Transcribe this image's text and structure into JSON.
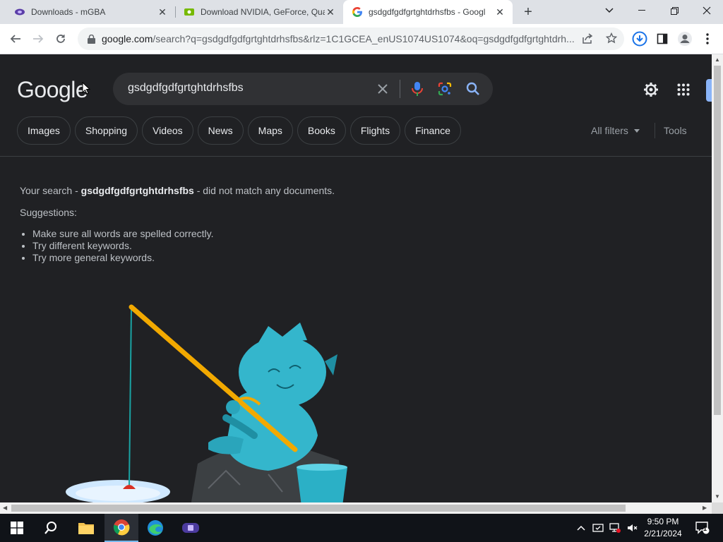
{
  "tabs": [
    {
      "title": "Downloads - mGBA",
      "icon": "mgba-icon"
    },
    {
      "title": "Download NVIDIA, GeForce, Qua",
      "icon": "nvidia-icon"
    },
    {
      "title": "gsdgdfgdfgrtghtdrhsfbs - Googl",
      "icon": "google-icon",
      "active": true
    }
  ],
  "address": {
    "host": "google.com",
    "path": "/search?q=gsdgdfgdfgrtghtdrhsfbs&rlz=1C1GCEA_enUS1074US1074&oq=gsdgdfgdfgrtghtdrh..."
  },
  "google": {
    "logo": "Google",
    "query": "gsdgdfgdfgrtghtdrhsfbs",
    "chips": [
      "Images",
      "Shopping",
      "Videos",
      "News",
      "Maps",
      "Books",
      "Flights",
      "Finance"
    ],
    "all_filters": "All filters",
    "tools": "Tools"
  },
  "results": {
    "prefix": "Your search - ",
    "query": "gsdgdfgdfgrtghtdrhsfbs",
    "suffix": " - did not match any documents.",
    "suggestions_title": "Suggestions:",
    "suggestions": [
      "Make sure all words are spelled correctly.",
      "Try different keywords.",
      "Try more general keywords."
    ]
  },
  "taskbar": {
    "time": "9:50 PM",
    "date": "2/21/2024",
    "notifications": "1"
  },
  "colors": {
    "page_bg": "#202124",
    "search_bg": "#303134",
    "text": "#e8eaed",
    "muted": "#bdc1c6",
    "accent": "#8ab4f8"
  }
}
